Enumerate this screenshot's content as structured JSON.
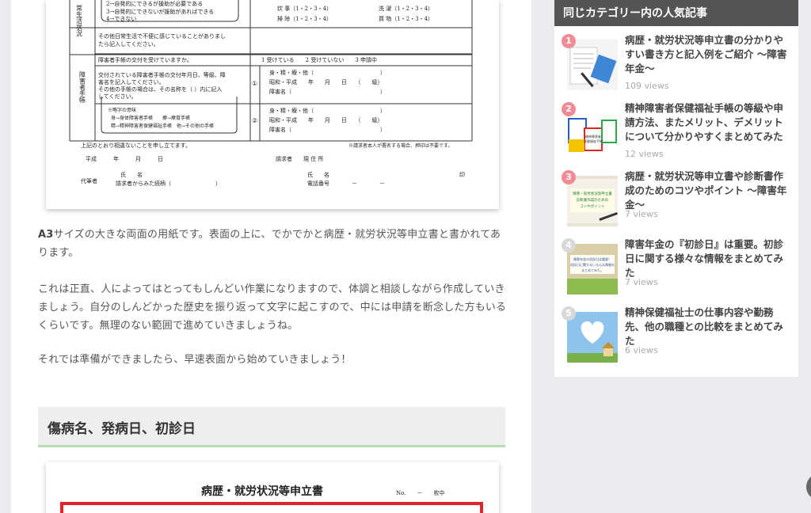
{
  "article": {
    "p1_bold": "A3",
    "p1_rest": "サイズの大きな両面の用紙です。表面の上に、でかでかと病歴・就労状況等申立書と書かれてあります。",
    "p2": "これは正直、人によってはとってもしんどい作業になりますので、体調と相談しながら作成していきましょう。自分のしんどかった歴史を振り返って文字に起こすので、中には申請を断念した方もいるくらいです。無理のない範囲で進めていきましょうね。",
    "p3": "それでは準備ができましたら、早速表面から始めていきましょう！",
    "h2": "傷病名、発病日、初診日"
  },
  "form_top": {
    "side_label_1": "常生活状況",
    "opt2": "2→自発的にできるが援助が必要である",
    "opt3": "3→自発的にできないが援助があればできる",
    "opt4": "4→できない",
    "meal": "炊 事（1・2・3・4）",
    "laundry": "洗 濯（1・2・3・4）",
    "cleaning": "掃 除（1・2・3・4）",
    "shopping": "買 物（1・2・3・4）",
    "other_note_1": "その他日常生活で不便に感じていることがありまし",
    "other_note_2": "たら記入してください。",
    "side_label_2": "障害者手帳",
    "q_handbook": "障害者手帳の交付を受けていますか。",
    "a_handbook": "1 受けている　　2 受けていない　　3 申請中",
    "desc1": "交付されている障害者手帳の交付年月日、等級、障",
    "desc2": "害名を記入してください。",
    "desc3": "その他の手帳の場合は、その名称を（ ）内に記入",
    "desc4": "してください。",
    "legend0": "※略字の意味",
    "legend1": "身→身体障害者手帳　　療→療育手帳",
    "legend2": "精→精神障害者保健福祉手帳　他→その他の手帳",
    "c1": "①",
    "c2": "②",
    "row_a": "身・精・療・他（　　　　　　　　　　　　）",
    "row_b": "昭和・平成　　年　　月　　日　　（　　級）",
    "row_c": "障害名（　　　　　　　　　　　　　　　　）",
    "footer1": "上記のとおり相違ないことを申し立てます。",
    "footer_note": "※請求者本人が署名する場合、押印は不要です。",
    "heisei": "平成　　　年　　　月　　　日",
    "claimant": "請求者　　現 住 所",
    "name1": "氏　　名",
    "name2": "氏　　名",
    "seal": "印",
    "proxy": "代筆者",
    "relation": "請求者からみた続柄（　　　　　　　　）",
    "phone": "電話番号　　　　－　　　　－"
  },
  "form_bottom": {
    "title": "病歴・就労状況等申立書",
    "no": "No.　　－　　枚中"
  },
  "sidebar": {
    "title": "同じカテゴリー内の人気記事",
    "items": [
      {
        "rank": "1",
        "title": "病歴・就労状況等申立書の分かりやすい書き方と記入例をご紹介 〜障害年金〜",
        "views": "109 views"
      },
      {
        "rank": "2",
        "title": "精神障害者保健福祉手帳の等級や申請方法、またメリット、デメリットについて分かりやすくまとめてみた",
        "views": "12 views"
      },
      {
        "rank": "3",
        "title": "病歴・就労状況等申立書や診断書作成のためのコツやポイント 〜障害年金〜",
        "views": "7 views"
      },
      {
        "rank": "4",
        "title": "障害年金の『初診日』は重要。初診日に関する様々な情報をまとめてみた",
        "views": "7 views"
      },
      {
        "rank": "5",
        "title": "精神保健福祉士の仕事内容や勤務先、他の職種との比較をまとめてみた",
        "views": "6 views"
      }
    ],
    "thumb_texts": {
      "t2_a": "精神障害者",
      "t2_b": "保健福祉手帳",
      "t3_a": "障害・就労状況等申立書",
      "t3_b": "診断書作成のための",
      "t3_c": "コツやポイント",
      "t4_a": "障害年金の初診日は重要！",
      "t4_b": "初診日に関するいろんな情報を",
      "t4_c": "まとめてみた。"
    }
  }
}
